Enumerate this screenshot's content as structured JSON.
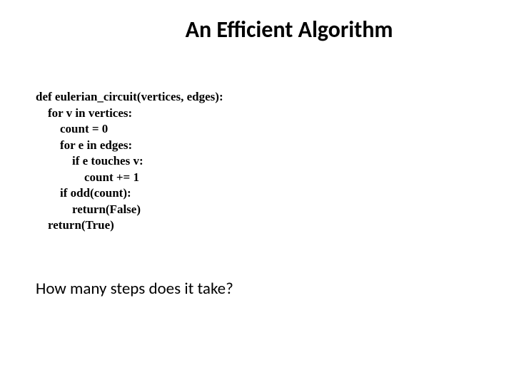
{
  "title": "An Efficient Algorithm",
  "code": {
    "line1": "def eulerian_circuit(vertices, edges):",
    "line2": "    for v in vertices:",
    "line3": "        count = 0",
    "line4": "        for e in edges:",
    "line5": "            if e touches v:",
    "line6": "                count += 1",
    "line7": "        if odd(count):",
    "line8": "            return(False)",
    "line9": "    return(True)"
  },
  "question": "How many steps does it take?"
}
